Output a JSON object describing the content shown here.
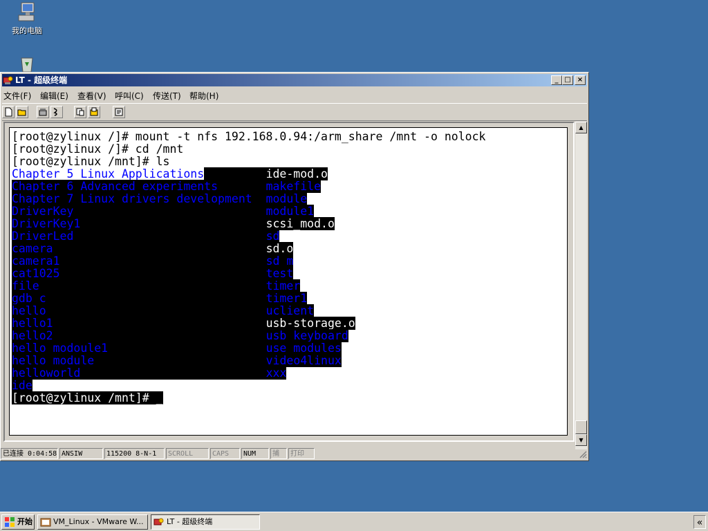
{
  "desktop": {
    "my_computer_label": "我的电脑"
  },
  "window": {
    "title": "LT - 超级终端",
    "controls": {
      "minimize": "_",
      "maximize": "□",
      "close": "×"
    }
  },
  "menu": [
    "文件(F)",
    "编辑(E)",
    "查看(V)",
    "呼叫(C)",
    "传送(T)",
    "帮助(H)"
  ],
  "terminal": {
    "lines": [
      {
        "left": "[root@zylinux /]# mount -t nfs 192.168.0.94:/arm_share /mnt -o nolock",
        "right": ""
      },
      {
        "left": "[root@zylinux /]# cd /mnt",
        "right": ""
      },
      {
        "left": "[root@zylinux /mnt]# ls",
        "right": ""
      }
    ],
    "listing_left": [
      "Chapter_5_Linux_Applications",
      "Chapter_6_Advanced_experiments",
      "Chapter_7_Linux_drivers_development",
      "DriverKey",
      "DriverKey1",
      "DriverLed",
      "camera",
      "camera1",
      "cat1025",
      "file",
      "gdb_c",
      "hello",
      "hello1",
      "hello2",
      "hello_modoule1",
      "hello_module",
      "helloworld",
      "ide"
    ],
    "listing_right": [
      "ide-mod.o",
      "makefile",
      "module",
      "module1",
      "scsi_mod.o",
      "sd",
      "sd.o",
      "sd_m",
      "test",
      "timer",
      "timer1",
      "uclient",
      "usb-storage.o",
      "usb_keyboard",
      "use_modules",
      "video4linux",
      "xxx"
    ],
    "right_white": [
      "ide-mod.o",
      "scsi_mod.o",
      "sd.o",
      "usb-storage.o"
    ],
    "prompt": "[root@zylinux /mnt]# _"
  },
  "statusbar": {
    "connected": "已连接 0:04:58",
    "emulation": "ANSIW",
    "port": "115200 8-N-1",
    "scroll": "SCROLL",
    "caps": "CAPS",
    "num": "NUM",
    "capture": "捕",
    "print": "打印"
  },
  "taskbar": {
    "start": "开始",
    "items": [
      "VM_Linux - VMware W...",
      "LT - 超级终端"
    ],
    "tray_chevron": "«"
  },
  "colors": {
    "desktop": "#3a6ea5",
    "title_active_start": "#0a246a",
    "title_active_end": "#a6caf0",
    "link_blue": "#0000ff"
  }
}
